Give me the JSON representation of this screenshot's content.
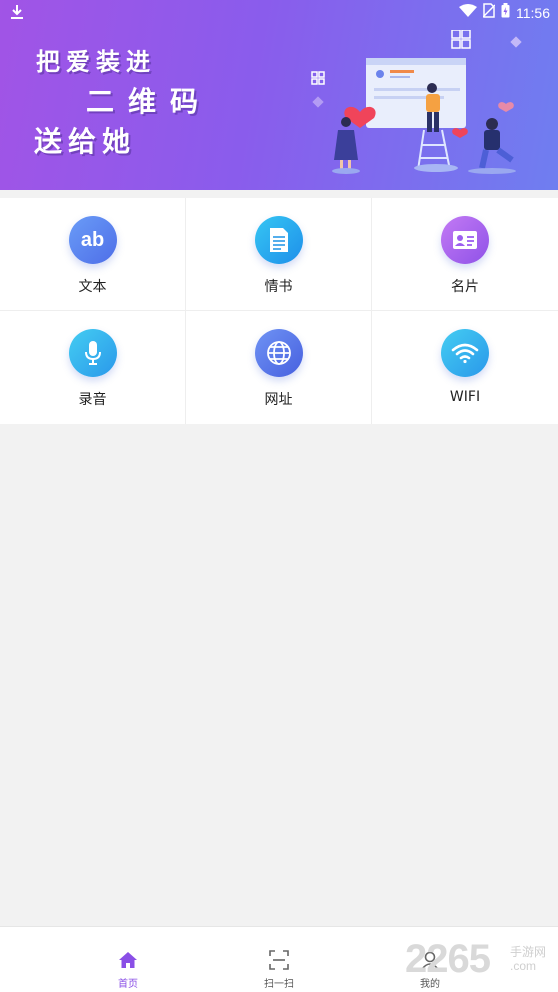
{
  "status_bar": {
    "time": "11:56"
  },
  "banner": {
    "slogan_line1": "把爱装进",
    "slogan_line2": "二维码",
    "slogan_line3": "送给她"
  },
  "grid": {
    "items": [
      {
        "label": "文本",
        "icon": "ab-text-icon",
        "colors": [
          "#6a9cf7",
          "#4e6ee8"
        ],
        "glyph": "ab"
      },
      {
        "label": "情书",
        "icon": "letter-document-icon",
        "colors": [
          "#36c6f3",
          "#1e8fea"
        ]
      },
      {
        "label": "名片",
        "icon": "business-card-icon",
        "colors": [
          "#c37af4",
          "#8f52e8"
        ]
      },
      {
        "label": "录音",
        "icon": "microphone-icon",
        "colors": [
          "#44cdf2",
          "#2a98ea"
        ]
      },
      {
        "label": "网址",
        "icon": "globe-icon",
        "colors": [
          "#6f93f4",
          "#4760df"
        ]
      },
      {
        "label": "WIFI",
        "icon": "wifi-icon",
        "colors": [
          "#44cdf2",
          "#2a98ea"
        ]
      }
    ]
  },
  "bottom_nav": {
    "home": "首页",
    "scan": "扫一扫",
    "mine": "我的",
    "active_color": "#8a4fe6"
  },
  "watermark": {
    "number": "2265",
    "site_cn": "手游网",
    "site_en": ".com"
  }
}
